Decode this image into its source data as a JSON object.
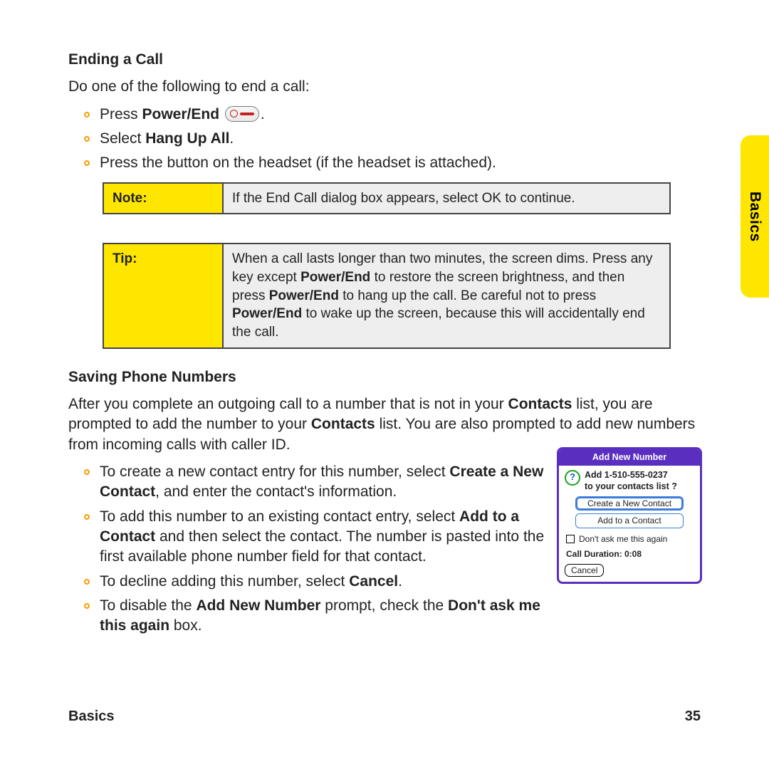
{
  "side_tab": "Basics",
  "sec1": {
    "title": "Ending a Call",
    "intro": "Do one of the following to end a call:",
    "b1_pre": "Press ",
    "b1_bold": "Power/End",
    "b1_post": ".",
    "b2_pre": "Select ",
    "b2_bold": "Hang Up All",
    "b2_post": ".",
    "b3": "Press the button on the headset (if the headset is attached)."
  },
  "note": {
    "label": "Note:",
    "text": "If the End Call dialog box appears, select OK to continue."
  },
  "tip": {
    "label": "Tip:",
    "t1": "When a call lasts longer than two minutes, the screen dims. Press any key except ",
    "t2": "Power/End",
    "t3": " to restore the screen brightness, and then press ",
    "t4": "Power/End",
    "t5": " to hang up the call. Be careful not to press ",
    "t6": "Power/End",
    "t7": " to wake up the screen, because this will accidentally end the call."
  },
  "sec2": {
    "title": "Saving Phone Numbers",
    "p_a": "After you complete an outgoing call to a number that is not in your ",
    "p_b": "Contacts",
    "p_c": " list, you are prompted to add the number to your ",
    "p_d": "Contacts",
    "p_e": " list. You are also prompted to add new numbers from incoming calls with caller ID.",
    "b1_a": "To create a new contact entry for this number, select ",
    "b1_b": "Create a New Contact",
    "b1_c": ", and enter the contact's information.",
    "b2_a": "To add this number to an existing contact entry, select ",
    "b2_b": "Add to a Contact",
    "b2_c": " and then select the contact. The number is pasted into the first available phone number field for that contact.",
    "b3_a": "To decline adding this number, select ",
    "b3_b": "Cancel",
    "b3_c": ".",
    "b4_a": "To disable the ",
    "b4_b": "Add New Number",
    "b4_c": " prompt, check the ",
    "b4_d": "Don't ask me this again",
    "b4_e": " box."
  },
  "dialog": {
    "title": "Add New Number",
    "line1": "Add 1-510-555-0237",
    "line2": "to your contacts list ?",
    "btn1": "Create a New Contact",
    "btn2": "Add to a Contact",
    "chk": "Don't ask me this again",
    "dur": "Call Duration: 0:08",
    "cancel": "Cancel"
  },
  "footer": {
    "left": "Basics",
    "right": "35"
  }
}
